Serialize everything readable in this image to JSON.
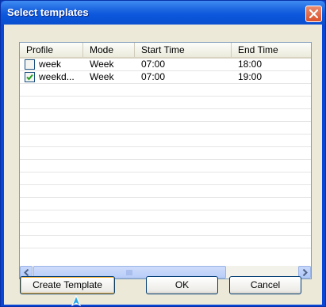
{
  "dialog": {
    "title": "Select templates"
  },
  "table": {
    "columns": [
      "Profile",
      "Mode",
      "Start Time",
      "End Time"
    ],
    "rows": [
      {
        "checked": false,
        "profile": "week",
        "mode": "Week",
        "start": "07:00",
        "end": "18:00"
      },
      {
        "checked": true,
        "profile": "weekd...",
        "mode": "Week",
        "start": "07:00",
        "end": "19:00"
      }
    ],
    "empty_rows": 13
  },
  "buttons": {
    "create_template": "Create Template",
    "ok": "OK",
    "cancel": "Cancel"
  },
  "colors": {
    "title_bar": "#0b57dc",
    "client_bg": "#ece9d8",
    "close_button": "#d9512c",
    "checkmark": "#21a121"
  },
  "icons": {
    "close": "close-icon",
    "checkmark": "checkmark-icon",
    "scroll_left": "arrow-left-icon",
    "scroll_right": "arrow-right-icon",
    "cursor": "mouse-pointer-icon"
  }
}
